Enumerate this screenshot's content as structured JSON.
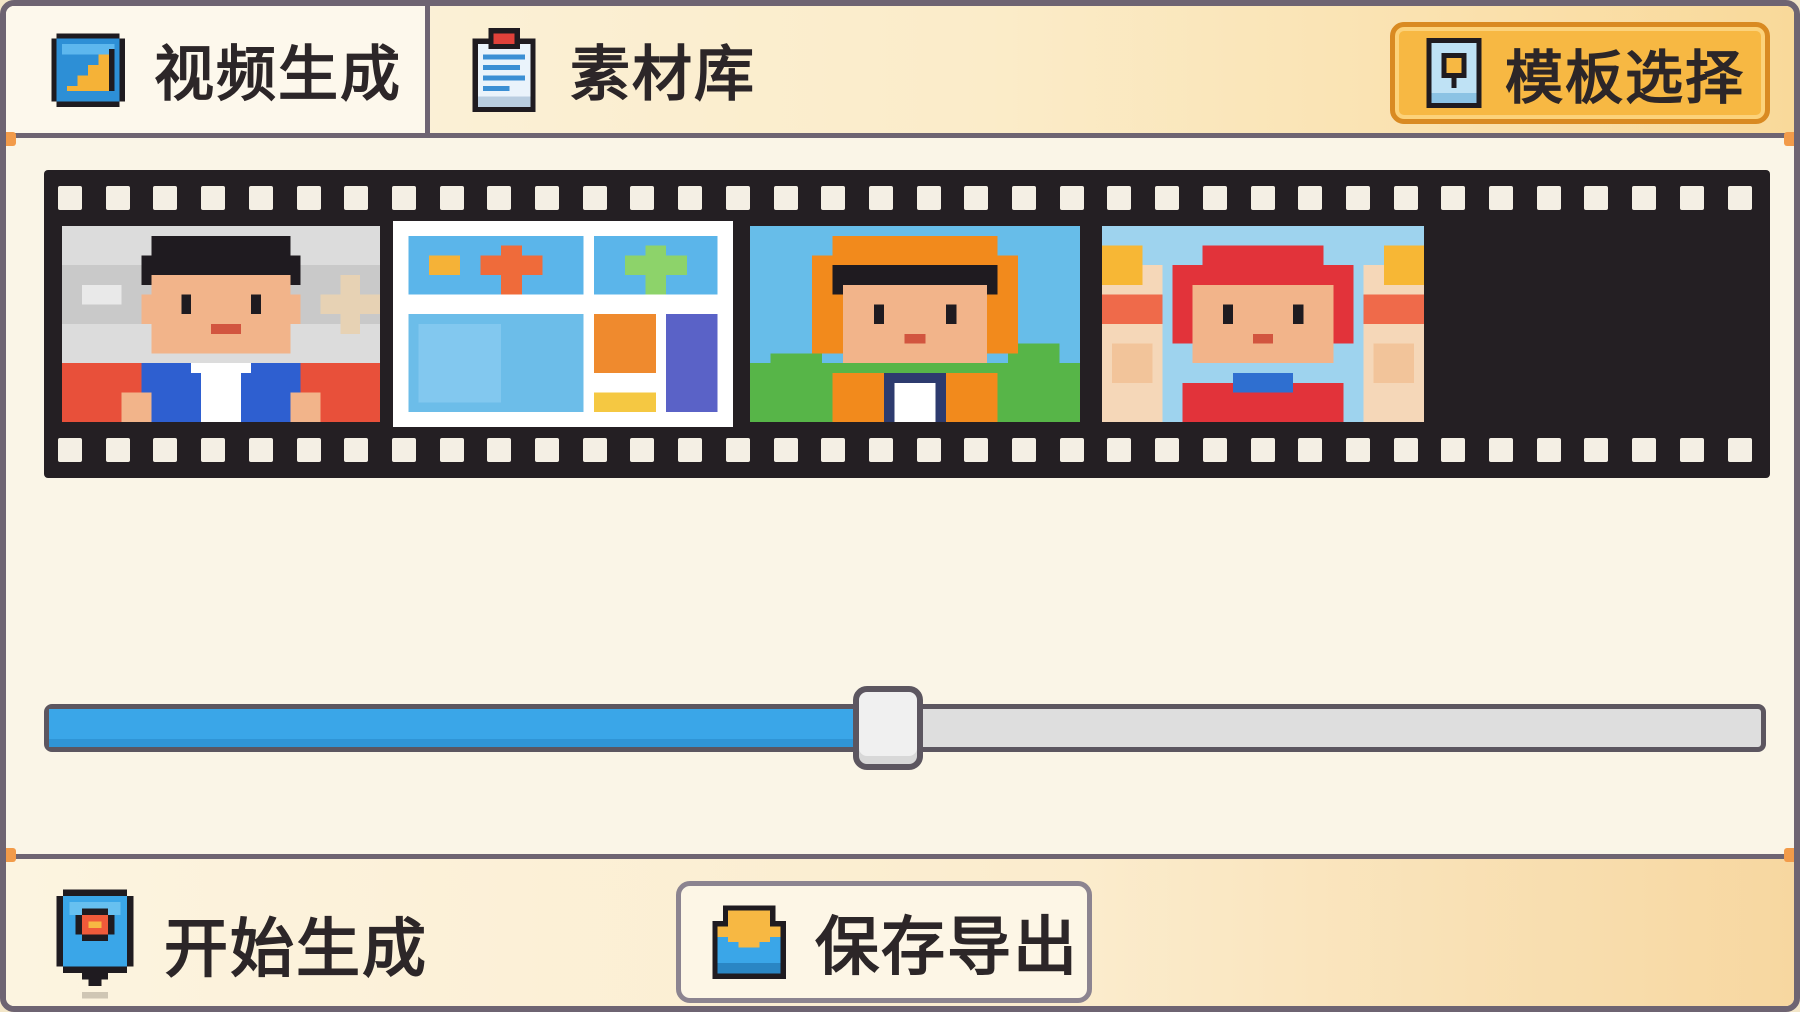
{
  "topbar": {
    "tabs": [
      {
        "label": "视频生成",
        "icon": "video-gen-icon",
        "active": true
      },
      {
        "label": "素材库",
        "icon": "clipboard-icon",
        "active": false
      }
    ],
    "template_button": {
      "label": "模板选择",
      "icon": "template-icon"
    }
  },
  "filmstrip": {
    "clips": [
      {
        "name": "clip-man-blue-suit",
        "selected": false
      },
      {
        "name": "clip-layout-blocks",
        "selected": true
      },
      {
        "name": "clip-orange-hood",
        "selected": false
      },
      {
        "name": "clip-red-hat",
        "selected": false
      }
    ],
    "empty_slots": 1
  },
  "timeline": {
    "progress": 0.49
  },
  "bottombar": {
    "start_button": {
      "label": "开始生成",
      "icon": "location-pin-icon"
    },
    "export_button": {
      "label": "保存导出",
      "icon": "envelope-icon"
    }
  },
  "colors": {
    "accent_blue": "#3aa6e8",
    "accent_orange": "#f7b843",
    "border": "#6e6472",
    "film": "#241f23"
  }
}
